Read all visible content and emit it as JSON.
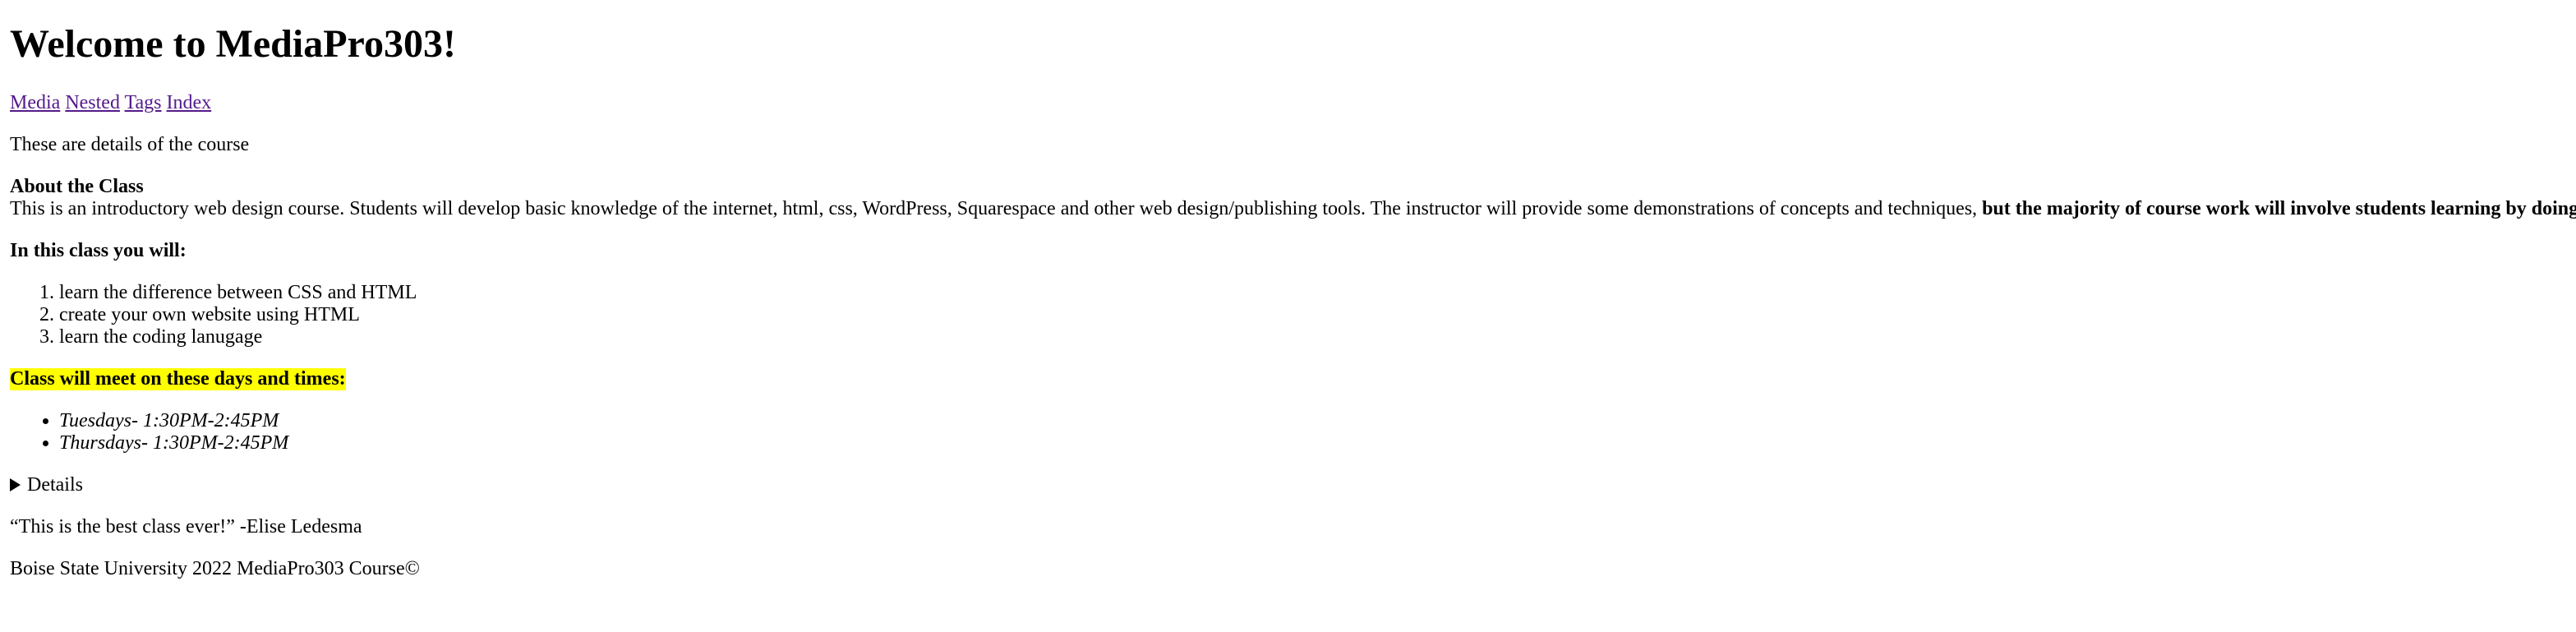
{
  "page": {
    "title": "Welcome to MediaPro303!"
  },
  "nav": {
    "links": [
      {
        "label": "Media"
      },
      {
        "label": "Nested"
      },
      {
        "label": "Tags"
      },
      {
        "label": "Index"
      }
    ]
  },
  "intro": {
    "text": "These are details of the course"
  },
  "about": {
    "heading": "About the Class",
    "body_plain": "This is an introductory web design course. Students will develop basic knowledge of the internet, html, css, WordPress, Squarespace and other web design/publishing tools. The instructor will provide some demonstrations of concepts and techniques, ",
    "body_bold": "but the majority of course work will involve students learning by doing"
  },
  "objectives": {
    "heading": "In this class you will:",
    "items": [
      "learn the difference between CSS and HTML",
      "create your own website using HTML",
      "learn the coding lanugage"
    ]
  },
  "schedule": {
    "heading": "Class will meet on these days and times:",
    "highlight_color": "#ffff00",
    "items": [
      "Tuesdays- 1:30PM-2:45PM",
      "Thursdays- 1:30PM-2:45PM"
    ]
  },
  "details": {
    "summary": "Details",
    "icon": "disclosure-triangle-right-icon"
  },
  "quote": {
    "text": "“This is the best class ever!” -Elise Ledesma"
  },
  "footer": {
    "text": "Boise State University 2022 MediaPro303 Course©"
  },
  "colors": {
    "link_visited": "#551a8b",
    "text": "#000000",
    "background": "#ffffff"
  }
}
